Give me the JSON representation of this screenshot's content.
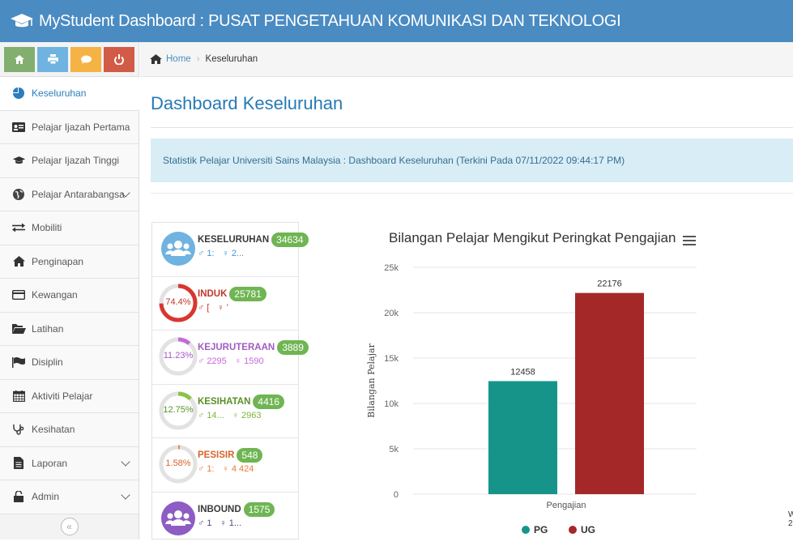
{
  "header": {
    "title": "MyStudent Dashboard : PUSAT PENGETAHUAN KOMUNIKASI DAN TEKNOLOGI"
  },
  "sidebar": {
    "shortcuts": [
      {
        "icon": "home-icon",
        "color": "#82af6f"
      },
      {
        "icon": "print-icon",
        "color": "#6fb3e0"
      },
      {
        "icon": "chat-icon",
        "color": "#f6b345"
      },
      {
        "icon": "power-icon",
        "color": "#d15b47"
      }
    ],
    "items": [
      {
        "label": "Keseluruhan",
        "icon": "pie-chart-icon",
        "active": true
      },
      {
        "label": "Pelajar Ijazah Pertama",
        "icon": "id-card-icon"
      },
      {
        "label": "Pelajar Ijazah Tinggi",
        "icon": "graduation-cap-icon"
      },
      {
        "label": "Pelajar Antarabangsa",
        "icon": "globe-icon",
        "has_submenu": true
      },
      {
        "label": "Mobiliti",
        "icon": "exchange-icon"
      },
      {
        "label": "Penginapan",
        "icon": "home-icon"
      },
      {
        "label": "Kewangan",
        "icon": "credit-card-icon"
      },
      {
        "label": "Latihan",
        "icon": "folder-open-icon"
      },
      {
        "label": "Disiplin",
        "icon": "flag-icon"
      },
      {
        "label": "Aktiviti Pelajar",
        "icon": "calendar-icon"
      },
      {
        "label": "Kesihatan",
        "icon": "stethoscope-icon"
      },
      {
        "label": "Laporan",
        "icon": "file-icon",
        "has_submenu": true
      },
      {
        "label": "Admin",
        "icon": "lock-icon",
        "has_submenu": true
      }
    ],
    "collapse_label": "«"
  },
  "breadcrumb": {
    "home": "Home",
    "current": "Keseluruhan"
  },
  "page_title": "Dashboard Keseluruhan",
  "alert": "Statistik Pelajar Universiti Sains Malaysia : Dashboard Keseluruhan (Terkini Pada 07/11/2022 09:44:17 PM)",
  "stats": [
    {
      "label": "KESELURUHAN",
      "count": "34634",
      "color": "#3a3a3a",
      "sub": [
        "1:",
        "2..."
      ],
      "sub_color": "#4a90d9",
      "pct": "",
      "kind": "people",
      "icon_color": "#6fb3e0"
    },
    {
      "label": "INDUK",
      "count": "25781",
      "color": "#c0392b",
      "sub": "['9(', '10138']",
      "sub_color": "#c0392b",
      "pct": "74.4%",
      "kind": "ring",
      "ring_color": "#d9362f",
      "fraction": 0.744
    },
    {
      "label": "KEJURUTERAAN",
      "count": "3889",
      "color": "#a05cc4",
      "sub": [
        "2295",
        "1590"
      ],
      "sub_color": "#c36ad8",
      "pct": "11.23%",
      "kind": "ring",
      "ring_color": "#c36ad8",
      "fraction": 0.1123
    },
    {
      "label": "KESIHATAN",
      "count": "4416",
      "color": "#5a8f2a",
      "sub": [
        "14...",
        "2963"
      ],
      "sub_color": "#7cb33a",
      "pct": "12.75%",
      "kind": "ring",
      "ring_color": "#8bc34a",
      "fraction": 0.1275
    },
    {
      "label": "PESISIR",
      "count": "548",
      "color": "#d6652c",
      "sub": [
        "1:",
        "4 424"
      ],
      "sub_color": "#e8793a",
      "pct": "1.58%",
      "kind": "ring",
      "ring_color": "#f08a4b",
      "fraction": 0.0158
    },
    {
      "label": "INBOUND",
      "count": "1575",
      "color": "#3a3a3a",
      "sub": [
        "1",
        "1..."
      ],
      "sub_color": "#4a4a7a",
      "pct": "",
      "kind": "people",
      "icon_color": "#8e5cc4"
    }
  ],
  "chart": {
    "title": "Bilangan Pelajar Mengikut Peringkat Pengajian",
    "menu_icon": "hamburger-menu-icon"
  },
  "chart_data": {
    "type": "bar",
    "categories": [
      "Pengajian"
    ],
    "series": [
      {
        "name": "PG",
        "values": [
          12458
        ],
        "color": "#17948a"
      },
      {
        "name": "UG",
        "values": [
          22176
        ],
        "color": "#a52828"
      }
    ],
    "data_labels": [
      "12458",
      "22176"
    ],
    "xlabel": "Pengajian",
    "ylabel": "Bilangan Pelajar",
    "ylim": [
      0,
      25000
    ],
    "yticks": [
      "0",
      "5k",
      "10k",
      "15k",
      "20k",
      "25k"
    ],
    "legend_position": "bottom",
    "grid": true
  },
  "cutoff_text": [
    "W",
    "2"
  ]
}
